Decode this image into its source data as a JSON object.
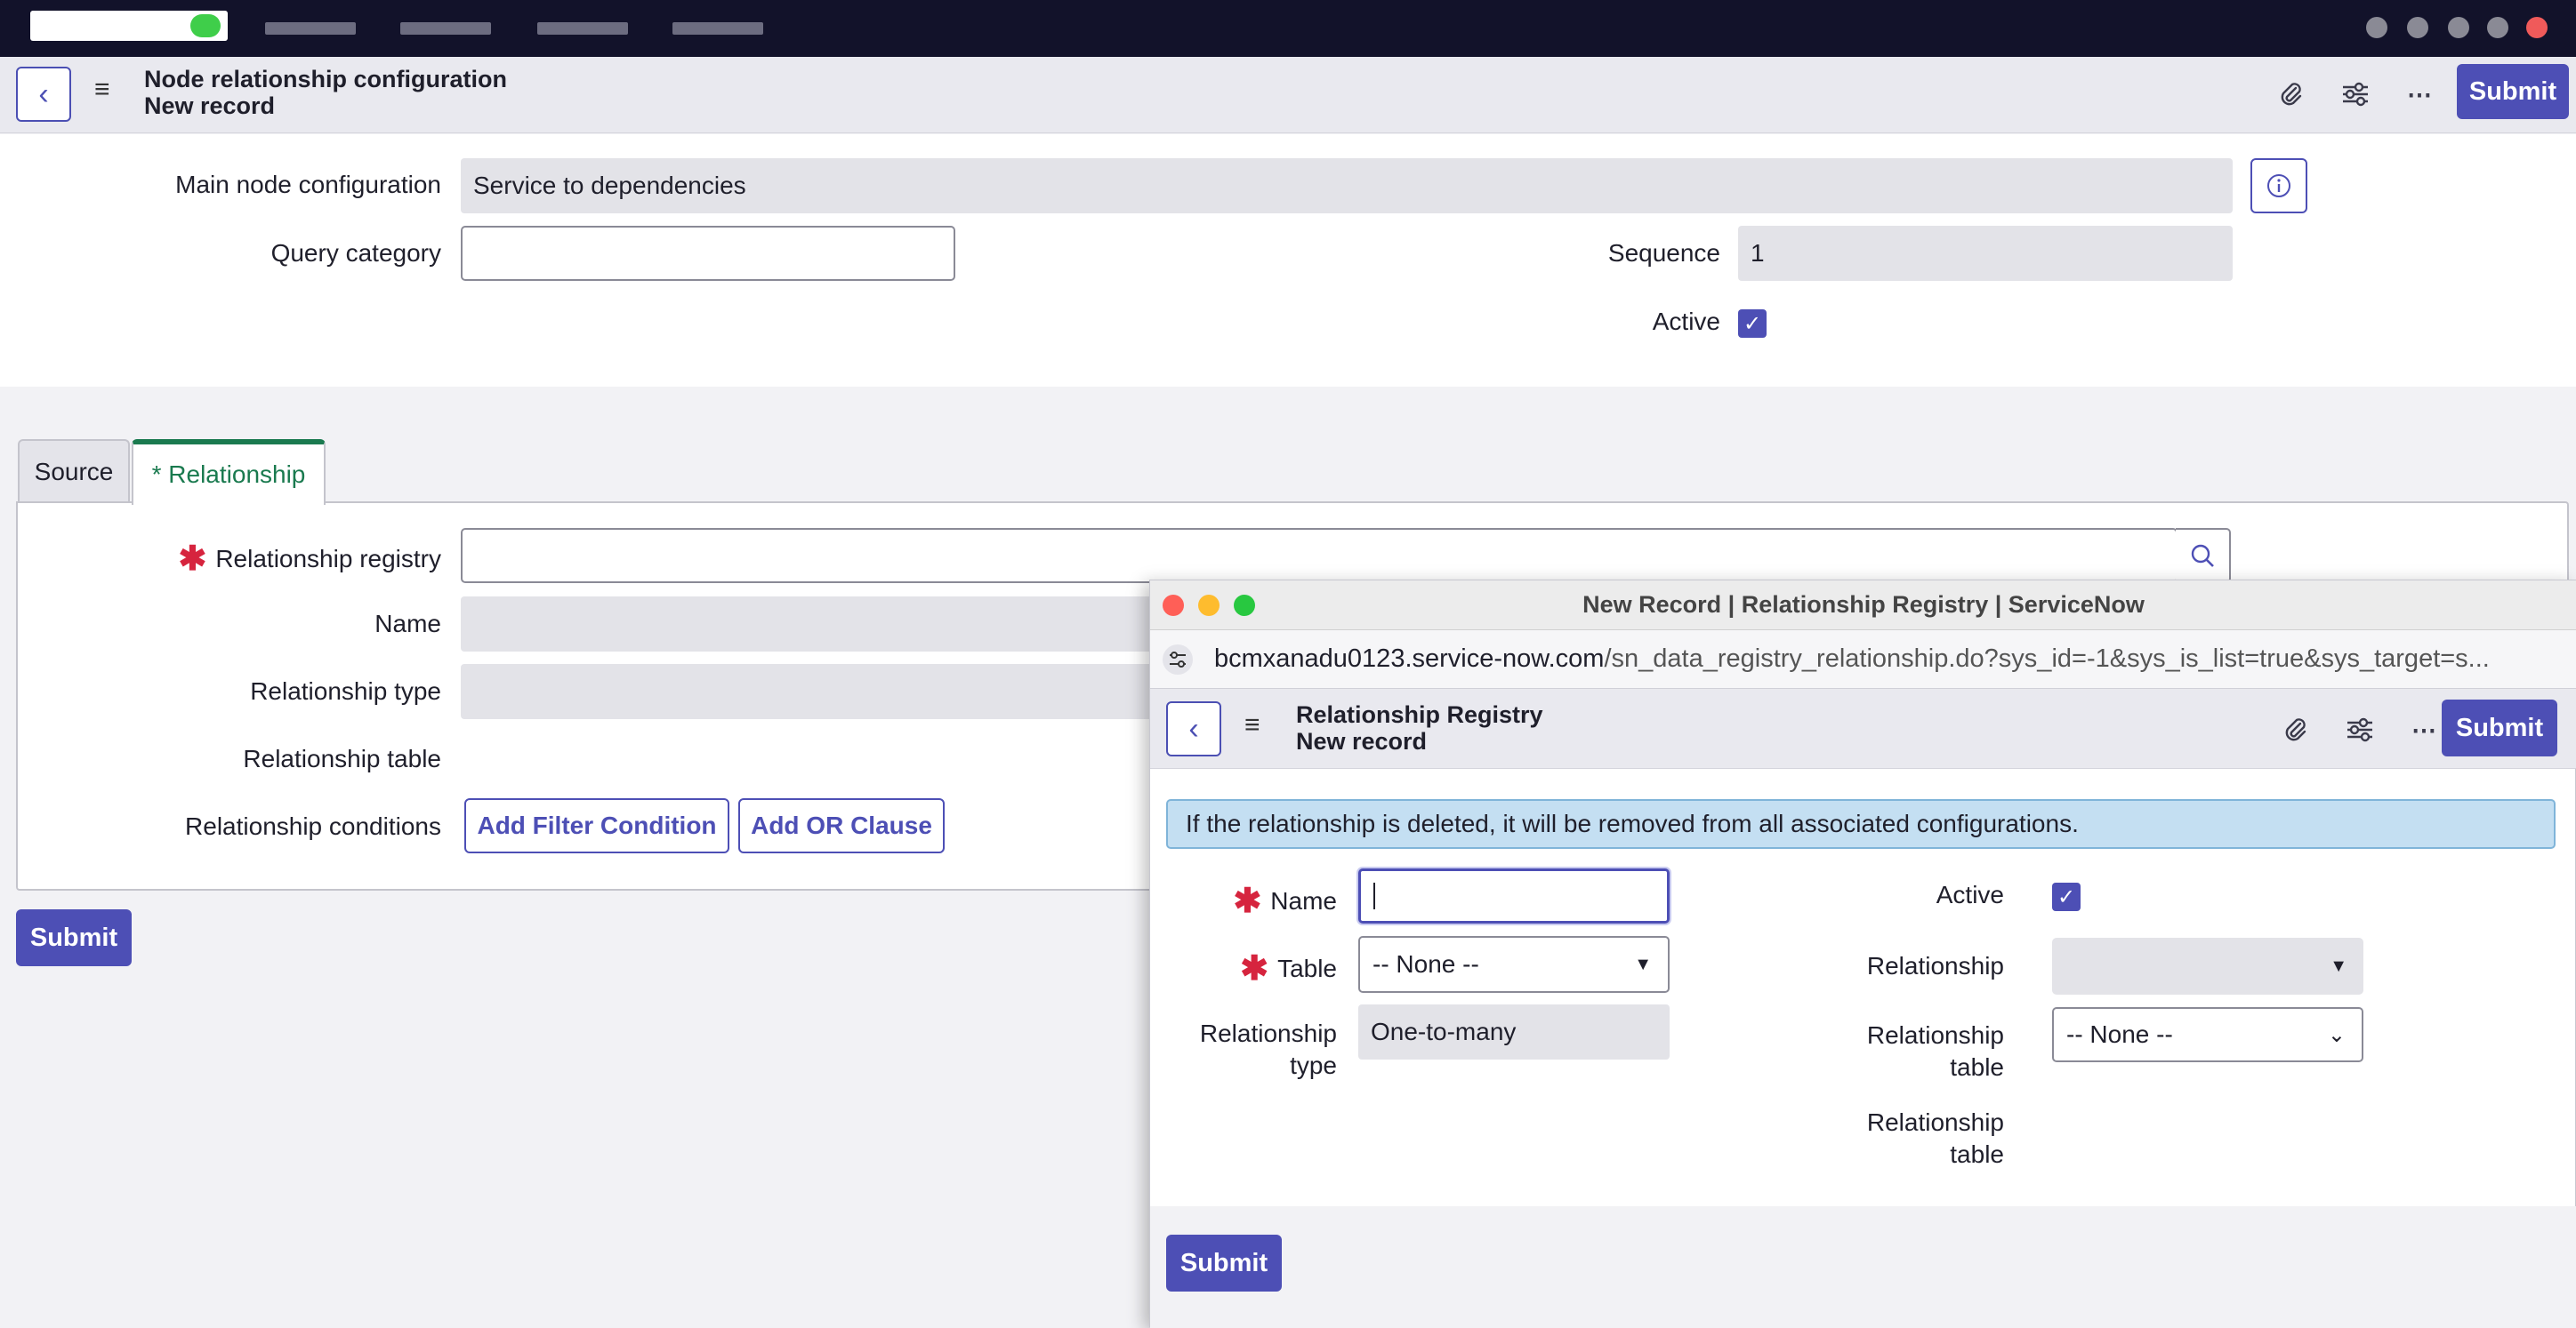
{
  "header": {
    "title": "Node relationship configuration",
    "subtitle": "New record",
    "submit_label": "Submit"
  },
  "form": {
    "main_node_label": "Main node configuration",
    "main_node_value": "Service to dependencies",
    "query_category_label": "Query category",
    "query_category_value": "",
    "sequence_label": "Sequence",
    "sequence_value": "1",
    "active_label": "Active"
  },
  "tabs": [
    {
      "label": "Source"
    },
    {
      "label": "* Relationship"
    }
  ],
  "relationship": {
    "registry_label": "Relationship registry",
    "name_label": "Name",
    "type_label": "Relationship type",
    "table_label": "Relationship table",
    "conditions_label": "Relationship conditions",
    "add_filter_label": "Add Filter Condition",
    "add_or_label": "Add OR Clause"
  },
  "bottom_submit_label": "Submit",
  "popup": {
    "window_title": "New Record | Relationship Registry | ServiceNow",
    "url_host": "bcmxanadu0123.service-now.com",
    "url_path": "/sn_data_registry_relationship.do?sys_id=-1&sys_is_list=true&sys_target=s...",
    "title": "Relationship Registry",
    "subtitle": "New record",
    "submit_label": "Submit",
    "banner": "If the relationship is deleted, it will be removed from all associated configurations.",
    "name_label": "Name",
    "name_value": "",
    "table_label": "Table",
    "table_value": "-- None --",
    "rel_type_label_1": "Relationship",
    "rel_type_label_2": "type",
    "rel_type_value": "One-to-many",
    "active_label": "Active",
    "relationship_label": "Relationship",
    "relationship_value": "",
    "rel_table_label_1": "Relationship",
    "rel_table_label_2": "table",
    "rel_table_value": "-- None --",
    "rel_table2_label_1": "Relationship",
    "rel_table2_label_2": "table",
    "bottom_submit_label": "Submit"
  },
  "colors": {
    "primary": "#4d4fb5",
    "required": "#d6243e",
    "tab_active": "#1a7a4f",
    "banner": "#c4dff2"
  },
  "icons": [
    "back-icon",
    "menu-icon",
    "paperclip-icon",
    "settings-icon",
    "more-icon",
    "info-icon",
    "search-icon",
    "check-icon",
    "chevron-down-icon",
    "url-settings-icon"
  ]
}
